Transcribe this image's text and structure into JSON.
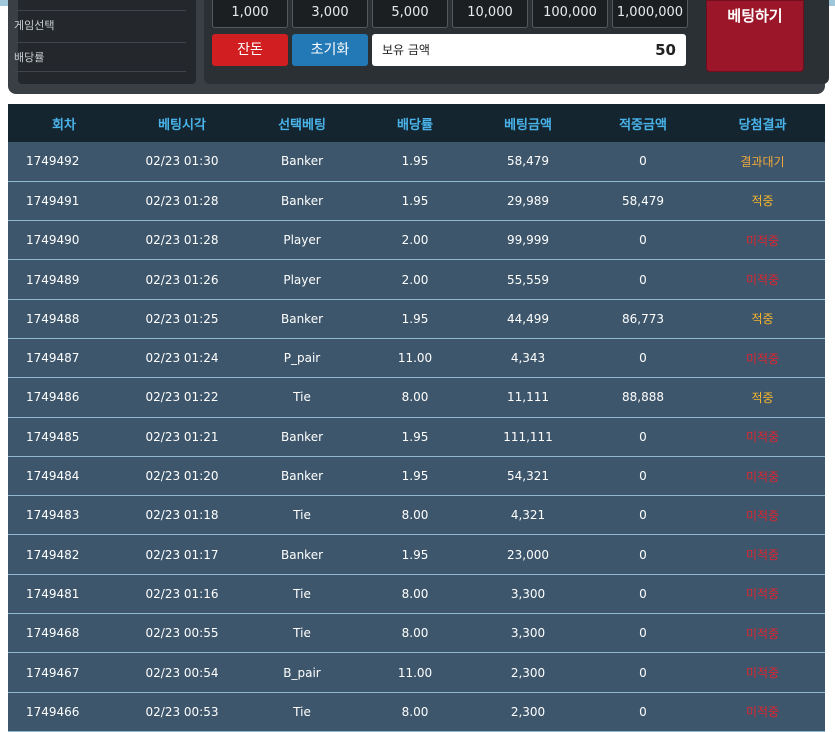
{
  "sidebar": {
    "items": [
      {
        "label": "게임선택"
      },
      {
        "label": "배당률"
      }
    ]
  },
  "chips": {
    "items": [
      "1,000",
      "3,000",
      "5,000",
      "10,000",
      "100,000",
      "1,000,000"
    ]
  },
  "controls": {
    "balance_button": "잔돈",
    "reset_button": "초기화",
    "balance_label": "보유 금액",
    "balance_amount": "50",
    "bet_button": "베팅하기"
  },
  "table": {
    "headers": [
      "회차",
      "베팅시각",
      "선택베팅",
      "배당률",
      "베팅금액",
      "적중금액",
      "당첨결과"
    ],
    "rows": [
      {
        "round": "1749492",
        "time": "02/23 01:30",
        "pick": "Banker",
        "odds": "1.95",
        "bet": "58,479",
        "win": "0",
        "result": "결과대기",
        "status": "wait"
      },
      {
        "round": "1749491",
        "time": "02/23 01:28",
        "pick": "Banker",
        "odds": "1.95",
        "bet": "29,989",
        "win": "58,479",
        "result": "적중",
        "status": "hit"
      },
      {
        "round": "1749490",
        "time": "02/23 01:28",
        "pick": "Player",
        "odds": "2.00",
        "bet": "99,999",
        "win": "0",
        "result": "미적중",
        "status": "miss"
      },
      {
        "round": "1749489",
        "time": "02/23 01:26",
        "pick": "Player",
        "odds": "2.00",
        "bet": "55,559",
        "win": "0",
        "result": "미적중",
        "status": "miss"
      },
      {
        "round": "1749488",
        "time": "02/23 01:25",
        "pick": "Banker",
        "odds": "1.95",
        "bet": "44,499",
        "win": "86,773",
        "result": "적중",
        "status": "hit"
      },
      {
        "round": "1749487",
        "time": "02/23 01:24",
        "pick": "P_pair",
        "odds": "11.00",
        "bet": "4,343",
        "win": "0",
        "result": "미적중",
        "status": "miss"
      },
      {
        "round": "1749486",
        "time": "02/23 01:22",
        "pick": "Tie",
        "odds": "8.00",
        "bet": "11,111",
        "win": "88,888",
        "result": "적중",
        "status": "hit"
      },
      {
        "round": "1749485",
        "time": "02/23 01:21",
        "pick": "Banker",
        "odds": "1.95",
        "bet": "111,111",
        "win": "0",
        "result": "미적중",
        "status": "miss"
      },
      {
        "round": "1749484",
        "time": "02/23 01:20",
        "pick": "Banker",
        "odds": "1.95",
        "bet": "54,321",
        "win": "0",
        "result": "미적중",
        "status": "miss"
      },
      {
        "round": "1749483",
        "time": "02/23 01:18",
        "pick": "Tie",
        "odds": "8.00",
        "bet": "4,321",
        "win": "0",
        "result": "미적중",
        "status": "miss"
      },
      {
        "round": "1749482",
        "time": "02/23 01:17",
        "pick": "Banker",
        "odds": "1.95",
        "bet": "23,000",
        "win": "0",
        "result": "미적중",
        "status": "miss"
      },
      {
        "round": "1749481",
        "time": "02/23 01:16",
        "pick": "Tie",
        "odds": "8.00",
        "bet": "3,300",
        "win": "0",
        "result": "미적중",
        "status": "miss"
      },
      {
        "round": "1749468",
        "time": "02/23 00:55",
        "pick": "Tie",
        "odds": "8.00",
        "bet": "3,300",
        "win": "0",
        "result": "미적중",
        "status": "miss"
      },
      {
        "round": "1749467",
        "time": "02/23 00:54",
        "pick": "B_pair",
        "odds": "11.00",
        "bet": "2,300",
        "win": "0",
        "result": "미적중",
        "status": "miss"
      },
      {
        "round": "1749466",
        "time": "02/23 00:53",
        "pick": "Tie",
        "odds": "8.00",
        "bet": "2,300",
        "win": "0",
        "result": "미적중",
        "status": "miss"
      }
    ]
  },
  "colors": {
    "header_bg": "#14252f",
    "header_text": "#49b3ea",
    "row_bg": "#3d566b",
    "result_hit": "#f7b52b",
    "result_miss": "#e0242f",
    "result_wait": "#f2a93a"
  }
}
